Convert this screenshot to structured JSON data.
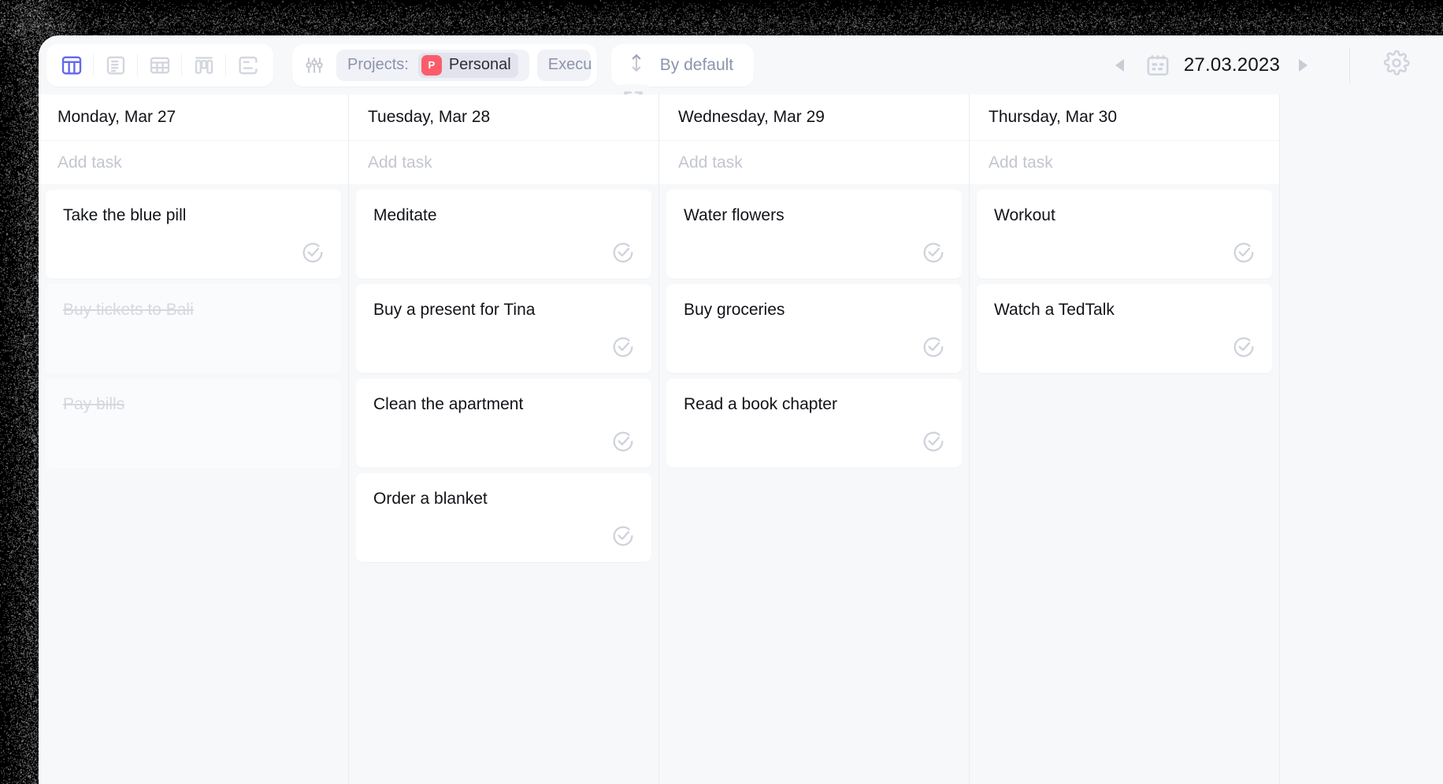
{
  "window": {
    "accent_color": "#6366f1",
    "project_badge_color": "#fb5c6c",
    "surface_color": "#f7f8fa"
  },
  "toolbar": {
    "views": [
      {
        "name": "board-view",
        "icon": "board-icon",
        "active": true
      },
      {
        "name": "list-view",
        "icon": "list-icon",
        "active": false
      },
      {
        "name": "table-view",
        "icon": "table-icon",
        "active": false
      },
      {
        "name": "kanban-view",
        "icon": "kanban-icon",
        "active": false
      },
      {
        "name": "timeline-view",
        "icon": "timeline-icon",
        "active": false
      }
    ],
    "filter": {
      "icon": "sliders-icon",
      "label": "Projects:",
      "badge": "P",
      "value": "Personal",
      "secondary_label": "Execu",
      "expand_icon": "expand-icon"
    },
    "sort": {
      "icon": "sort-arrows-icon",
      "label": "By default"
    },
    "date_nav": {
      "prev_icon": "prev-arrow-icon",
      "calendar_icon": "calendar-icon",
      "date": "27.03.2023",
      "next_icon": "next-arrow-icon"
    },
    "settings": {
      "icon": "gear-icon"
    }
  },
  "board": {
    "add_task_placeholder": "Add task",
    "columns": [
      {
        "header": "Monday, Mar 27",
        "tasks": [
          {
            "title": "Take the blue pill",
            "done": false
          },
          {
            "title": "Buy tickets to Bali",
            "done": true
          },
          {
            "title": "Pay bills",
            "done": true
          }
        ]
      },
      {
        "header": "Tuesday, Mar 28",
        "tasks": [
          {
            "title": "Meditate",
            "done": false
          },
          {
            "title": "Buy a present for Tina",
            "done": false
          },
          {
            "title": "Clean the apartment",
            "done": false
          },
          {
            "title": "Order a blanket",
            "done": false
          }
        ]
      },
      {
        "header": "Wednesday, Mar 29",
        "tasks": [
          {
            "title": "Water flowers",
            "done": false
          },
          {
            "title": "Buy groceries",
            "done": false
          },
          {
            "title": "Read a book chapter",
            "done": false
          }
        ]
      },
      {
        "header": "Thursday, Mar 30",
        "tasks": [
          {
            "title": "Workout",
            "done": false
          },
          {
            "title": "Watch a TedTalk",
            "done": false
          }
        ]
      }
    ]
  }
}
